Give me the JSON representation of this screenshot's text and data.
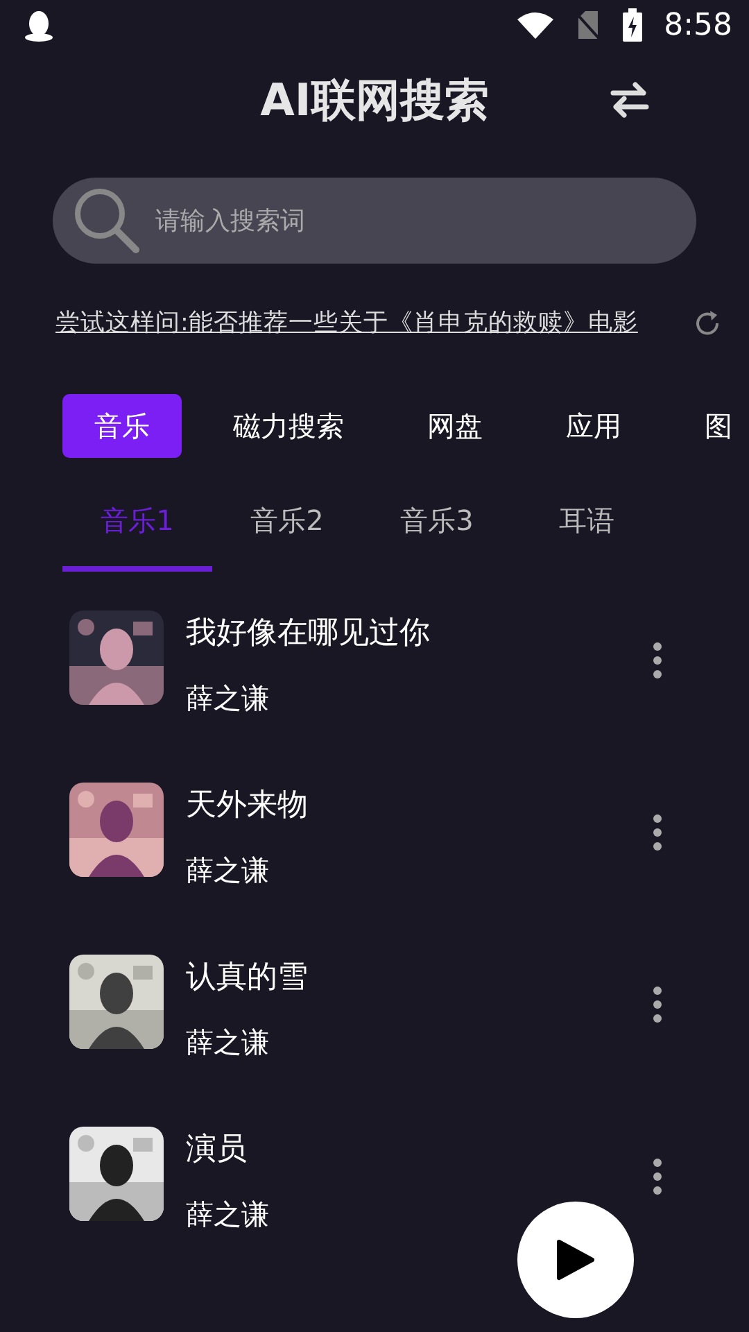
{
  "status_bar": {
    "time": "8:58"
  },
  "header": {
    "title": "AI联网搜索"
  },
  "search": {
    "placeholder": "请输入搜索词"
  },
  "suggestion": {
    "text": "尝试这样问:能否推荐一些关于《肖申克的救赎》电影"
  },
  "categories": [
    {
      "label": "音乐",
      "selected": true
    },
    {
      "label": "磁力搜索",
      "selected": false
    },
    {
      "label": "网盘",
      "selected": false
    },
    {
      "label": "应用",
      "selected": false
    },
    {
      "label": "图",
      "selected": false
    }
  ],
  "subtabs": [
    {
      "label": "音乐1",
      "selected": true
    },
    {
      "label": "音乐2",
      "selected": false
    },
    {
      "label": "音乐3",
      "selected": false
    },
    {
      "label": "耳语",
      "selected": false
    }
  ],
  "songs": [
    {
      "title": "我好像在哪见过你",
      "artist": "薛之谦"
    },
    {
      "title": "天外来物",
      "artist": "薛之谦"
    },
    {
      "title": "认真的雪",
      "artist": "薛之谦"
    },
    {
      "title": "演员",
      "artist": "薛之谦"
    }
  ]
}
